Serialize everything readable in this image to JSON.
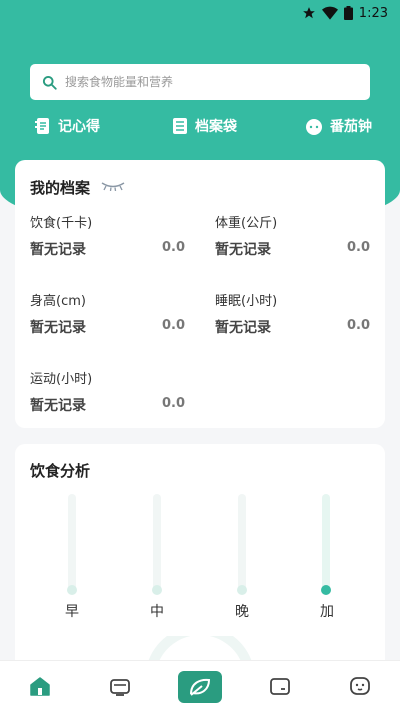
{
  "status": {
    "time": "1:23"
  },
  "search": {
    "placeholder": "搜索食物能量和营养"
  },
  "quick_links": [
    {
      "label": "记心得",
      "icon": "notebook-icon"
    },
    {
      "label": "档案袋",
      "icon": "folder-icon"
    },
    {
      "label": "番茄钟",
      "icon": "tomato-icon"
    }
  ],
  "profile": {
    "title": "我的档案",
    "fields": [
      {
        "label": "饮食(千卡)",
        "status": "暂无记录",
        "value": "0.0"
      },
      {
        "label": "体重(公斤)",
        "status": "暂无记录",
        "value": "0.0"
      },
      {
        "label": "身高(cm)",
        "status": "暂无记录",
        "value": "0.0"
      },
      {
        "label": "睡眠(小时)",
        "status": "暂无记录",
        "value": "0.0"
      },
      {
        "label": "运动(小时)",
        "status": "暂无记录",
        "value": "0.0"
      }
    ]
  },
  "diet": {
    "title": "饮食分析",
    "meals": [
      "早",
      "中",
      "晚",
      "加"
    ]
  },
  "colors": {
    "accent": "#35bba2",
    "accent_dark": "#2a9c80"
  },
  "tabbar": [
    "home-icon",
    "tv-icon",
    "leaf-icon",
    "wallet-icon",
    "face-icon"
  ]
}
